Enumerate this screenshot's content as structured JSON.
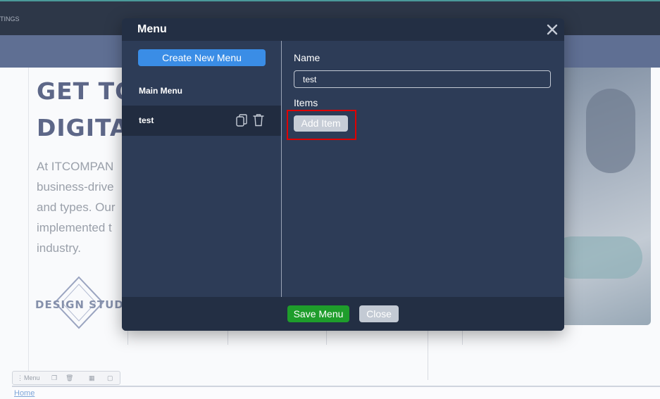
{
  "background": {
    "top_tag": "TINGS",
    "headline_1": "GET TO",
    "headline_2": "DIGITAL",
    "paragraph_lines": [
      "At ITCOMPAN",
      "business-drive",
      "and types. Our",
      "implemented t",
      "industry."
    ],
    "logo_text": "DESIGN STUDIO",
    "toolbar_label": "Menu",
    "home_link": "Home"
  },
  "modal": {
    "title": "Menu",
    "sidebar": {
      "create_button": "Create New Menu",
      "section_label": "Main Menu",
      "items": [
        {
          "label": "test"
        }
      ]
    },
    "main": {
      "name_label": "Name",
      "name_value": "test",
      "items_label": "Items",
      "add_item_button": "Add Item"
    },
    "footer": {
      "save_button": "Save Menu",
      "close_button": "Close"
    }
  },
  "colors": {
    "modal_bg": "#2d3c57",
    "header_bg": "#232f44",
    "primary_blue": "#3a8de6",
    "save_green": "#1e9d2b",
    "highlight_red": "#e00000"
  }
}
